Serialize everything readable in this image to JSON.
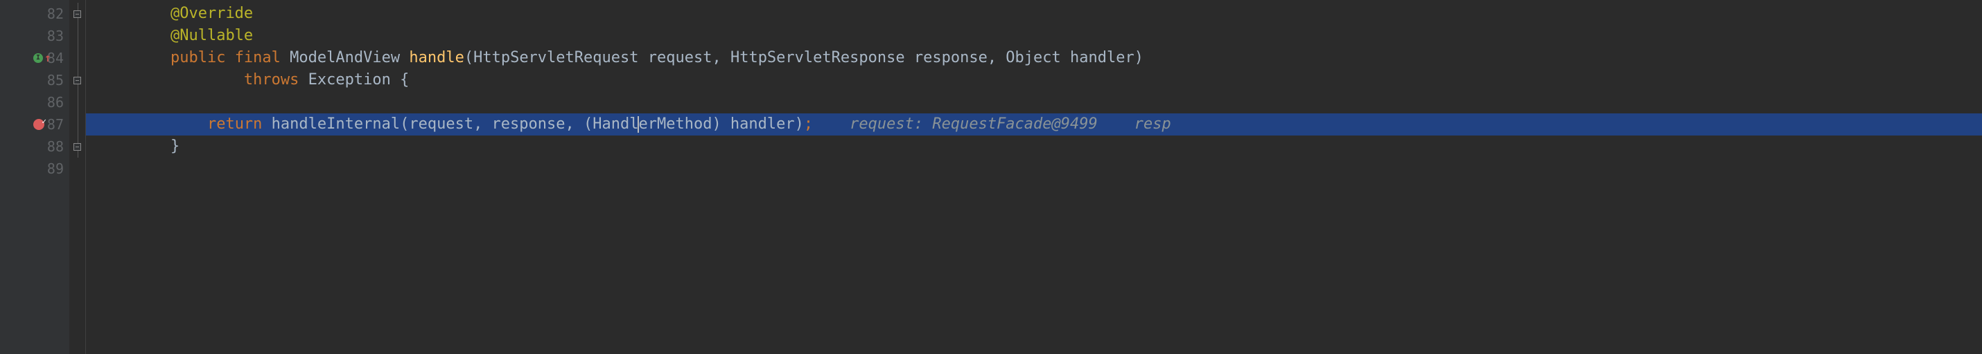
{
  "gutter": {
    "lines": [
      {
        "num": "82",
        "fold": "marker"
      },
      {
        "num": "83",
        "fold": "line"
      },
      {
        "num": "84",
        "icon": "override-up",
        "fold": "line"
      },
      {
        "num": "85",
        "fold": "marker"
      },
      {
        "num": "86",
        "fold": "line"
      },
      {
        "num": "87",
        "icon": "breakpoint",
        "fold": "line",
        "highlighted": true
      },
      {
        "num": "88",
        "fold": "marker"
      },
      {
        "num": "89",
        "fold": "none"
      }
    ]
  },
  "code": {
    "l82": {
      "indent": "        ",
      "annotation": "@Override"
    },
    "l83": {
      "indent": "        ",
      "annotation": "@Nullable"
    },
    "l84": {
      "indent": "        ",
      "kw_public": "public ",
      "kw_final": "final ",
      "ret_type": "ModelAndView ",
      "method": "handle",
      "params": "(HttpServletRequest request, HttpServletResponse response, Object handler)"
    },
    "l85": {
      "indent": "                ",
      "kw_throws": "throws ",
      "exc": "Exception ",
      "brace": "{"
    },
    "l86": {
      "indent": ""
    },
    "l87": {
      "indent": "            ",
      "kw_return": "return ",
      "call_pre": "handleInternal(request, response, (Handl",
      "call_post": "erMethod) handler)",
      "semi": ";",
      "hint_gap": "    ",
      "hint1": "request: RequestFacade@9499",
      "hint_gap2": "    ",
      "hint2": "resp"
    },
    "l88": {
      "indent": "        ",
      "brace": "}"
    },
    "l89": {
      "indent": ""
    }
  }
}
